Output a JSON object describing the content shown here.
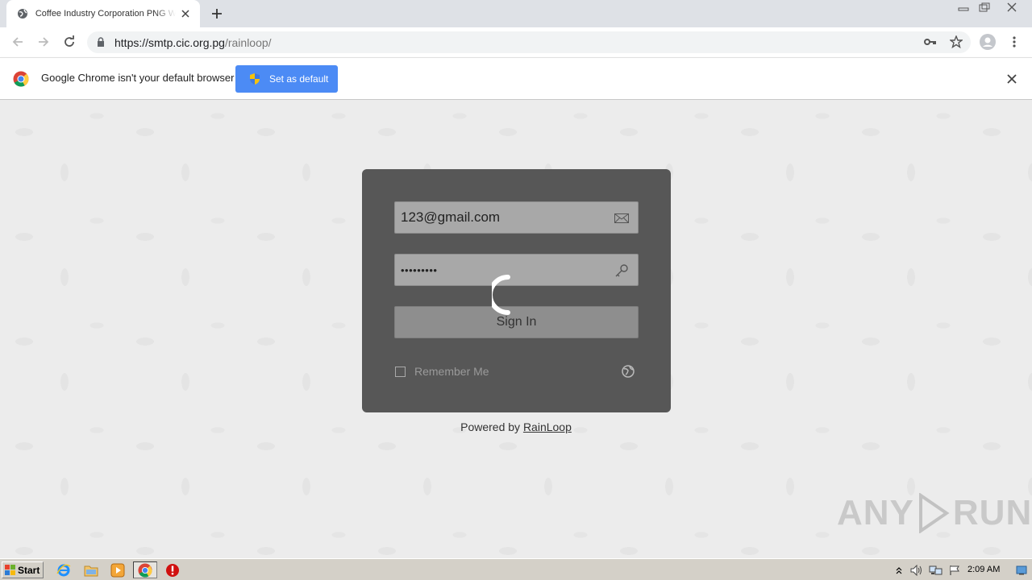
{
  "browser": {
    "tab_title": "Coffee Industry Corporation PNG Webmail",
    "url_host": "https://smtp.cic.org.pg",
    "url_path": "/rainloop/",
    "infobar_message": "Google Chrome isn't your default browser",
    "set_default_label": "Set as default"
  },
  "login": {
    "email_value": "123@gmail.com",
    "password_value": "•••••••••",
    "sign_in_label": "Sign In",
    "remember_label": "Remember Me",
    "remember_checked": false
  },
  "footer": {
    "powered_prefix": "Powered by ",
    "powered_link": "RainLoop"
  },
  "watermark": {
    "left": "ANY",
    "right": "RUN"
  },
  "taskbar": {
    "start_label": "Start",
    "clock": "2:09 AM"
  },
  "colors": {
    "infobar_button": "#4c8bf5",
    "login_card": "#575757",
    "field_bg": "#a8a8a8",
    "signin_bg": "#8e8e8e"
  }
}
